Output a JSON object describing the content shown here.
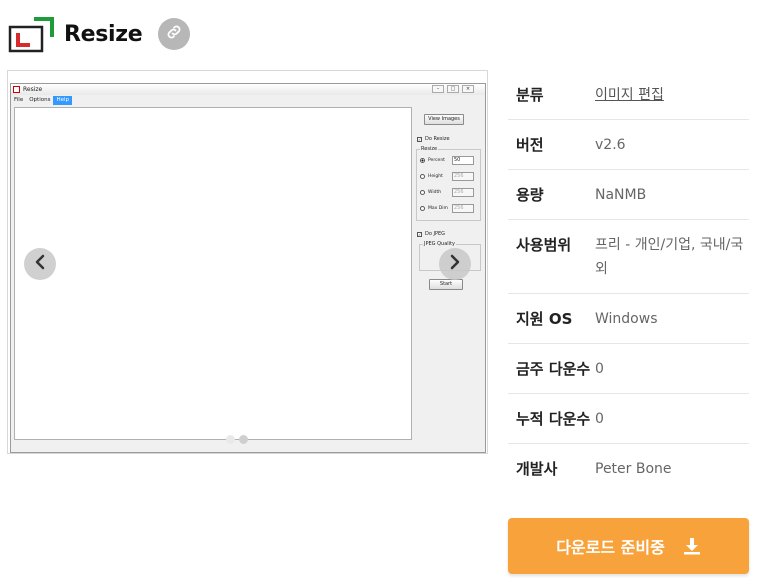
{
  "header": {
    "app_name": "Resize",
    "link_icon": "link-icon",
    "logo_icon": "resize-logo-icon"
  },
  "screenshot": {
    "window_title": "Resize",
    "menu": [
      "File",
      "Options",
      "Help"
    ],
    "active_menu": "Help",
    "view_images_label": "View Images",
    "do_resize_label": "Do Resize",
    "resize_group_label": "Resize",
    "radio_options": [
      {
        "label": "Percent",
        "value": "50",
        "selected": true
      },
      {
        "label": "Height",
        "value": "256",
        "selected": false
      },
      {
        "label": "Width",
        "value": "256",
        "selected": false
      },
      {
        "label": "Max Dim",
        "value": "256",
        "selected": false
      }
    ],
    "do_jpeg_label": "Do JPEG",
    "jpeg_quality_label": "JPEG Quality",
    "start_label": "Start",
    "slides_total": 2,
    "slide_active_index": 0
  },
  "info": {
    "category_key": "분류",
    "category_value": "이미지 편집",
    "version_key": "버전",
    "version_value": "v2.6",
    "size_key": "용량",
    "size_value": "NaNMB",
    "license_key": "사용범위",
    "license_value": "프리 - 개인/기업, 국내/국외",
    "os_key": "지원 OS",
    "os_value": "Windows",
    "weekly_key": "금주 다운수",
    "weekly_value": "0",
    "total_key": "누적 다운수",
    "total_value": "0",
    "developer_key": "개발사",
    "developer_value": "Peter Bone"
  },
  "download": {
    "label": "다운로드 준비중",
    "icon": "download-icon",
    "color": "#f7a23b"
  }
}
